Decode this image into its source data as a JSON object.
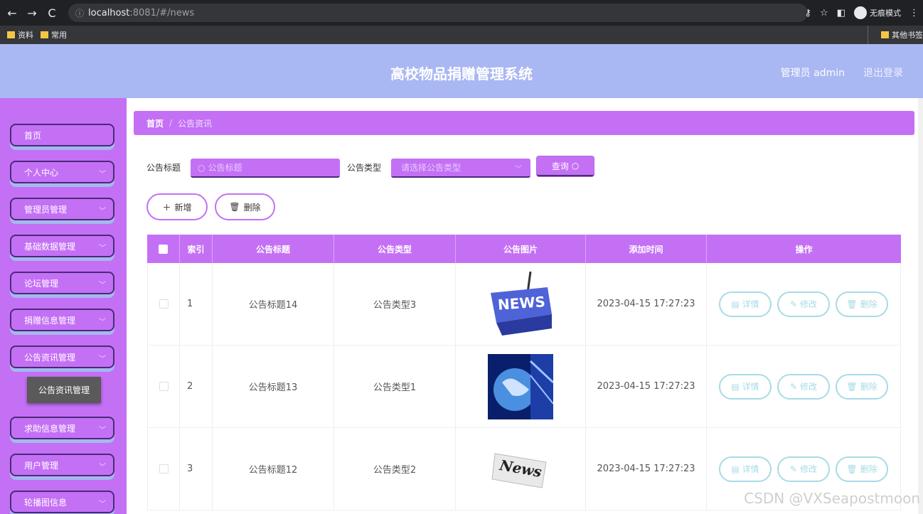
{
  "browser": {
    "url_host": "localhost",
    "url_path": ":8081/#/news",
    "incognito_label": "无痕模式",
    "bookmarks": [
      "资料",
      "常用"
    ],
    "other_bookmarks": "其他书签"
  },
  "header": {
    "title": "高校物品捐赠管理系统",
    "admin": "管理员 admin",
    "logout": "退出登录"
  },
  "sidebar": {
    "items": [
      {
        "label": "首页",
        "has_chevron": false
      },
      {
        "label": "个人中心",
        "has_chevron": true
      },
      {
        "label": "管理员管理",
        "has_chevron": true
      },
      {
        "label": "基础数据管理",
        "has_chevron": true
      },
      {
        "label": "论坛管理",
        "has_chevron": true
      },
      {
        "label": "捐赠信息管理",
        "has_chevron": true
      },
      {
        "label": "公告资讯管理",
        "has_chevron": true
      },
      {
        "label": "求助信息管理",
        "has_chevron": true
      },
      {
        "label": "用户管理",
        "has_chevron": true
      },
      {
        "label": "轮播图信息",
        "has_chevron": true
      }
    ],
    "submenu_label": "公告资讯管理"
  },
  "breadcrumb": {
    "home": "首页",
    "separator": "/",
    "current": "公告资讯"
  },
  "search": {
    "title_label": "公告标题",
    "title_placeholder": "公告标题",
    "type_label": "公告类型",
    "type_placeholder": "请选择公告类型",
    "query_button": "查询"
  },
  "actions": {
    "add": "新增",
    "delete": "删除"
  },
  "table": {
    "headers": [
      "索引",
      "公告标题",
      "公告类型",
      "公告图片",
      "添加时间",
      "操作"
    ],
    "rows": [
      {
        "index": "1",
        "title": "公告标题14",
        "type": "公告类型3",
        "image": "news-key",
        "time": "2023-04-15 17:27:23"
      },
      {
        "index": "2",
        "title": "公告标题13",
        "type": "公告类型1",
        "image": "globe-news",
        "time": "2023-04-15 17:27:23"
      },
      {
        "index": "3",
        "title": "公告标题12",
        "type": "公告类型2",
        "image": "newspaper",
        "time": "2023-04-15 17:27:23"
      }
    ],
    "op_buttons": {
      "detail": "详情",
      "edit": "修改",
      "delete": "删除"
    }
  },
  "watermark": "CSDN @VXSeapostmoon",
  "colors": {
    "accent": "#c470f5",
    "header_bg": "#a9b7f2",
    "op_border": "#a7dbe6"
  }
}
